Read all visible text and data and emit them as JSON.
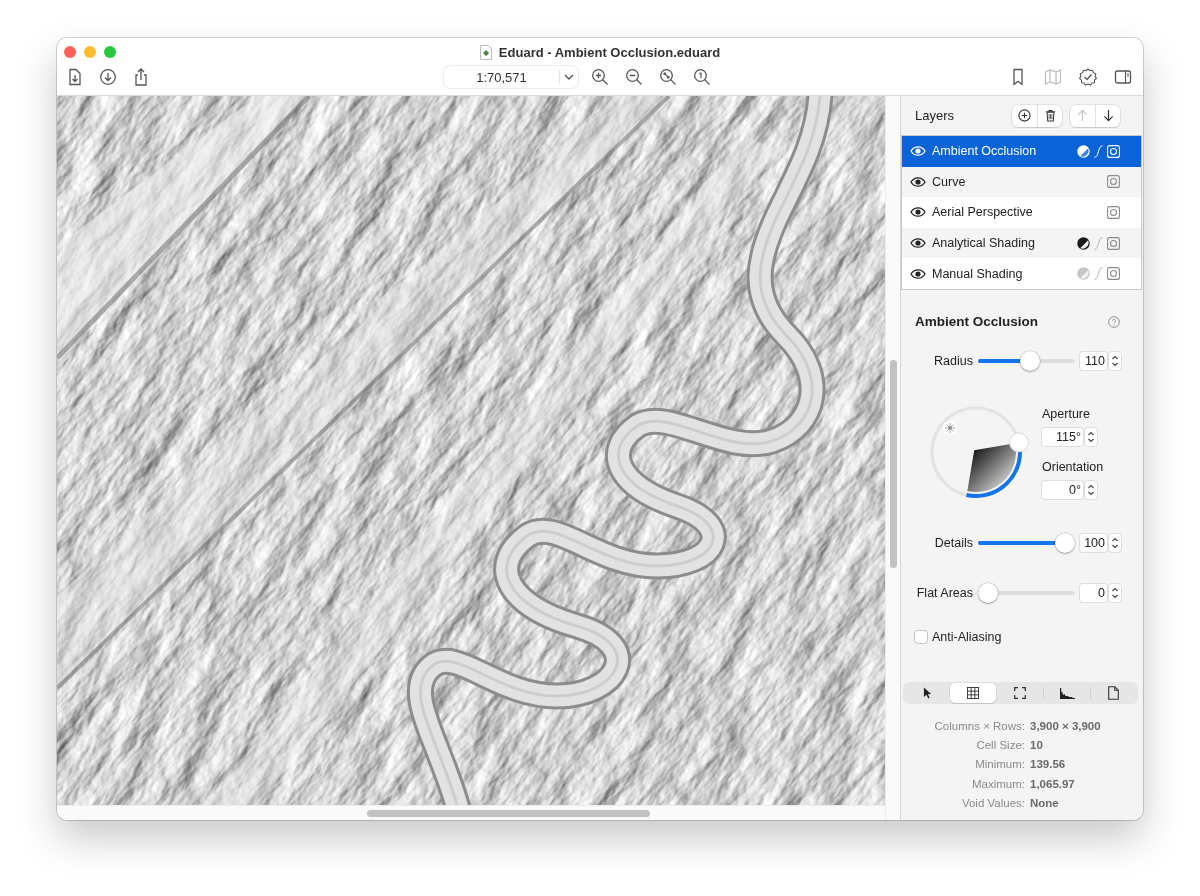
{
  "window": {
    "title": "Eduard - Ambient Occlusion.eduard"
  },
  "toolbar": {
    "scale": "1:70,571",
    "right_buttons": [
      {
        "disabled": false
      },
      {
        "disabled": true
      },
      {
        "disabled": false
      },
      {
        "disabled": false
      }
    ]
  },
  "layers": {
    "title": "Layers",
    "buttons": [
      {
        "disabled": false
      },
      {
        "disabled": false
      },
      {
        "disabled": true
      },
      {
        "disabled": false
      }
    ],
    "items": [
      {
        "name": "Ambient Occlusion",
        "selected": true,
        "visible": true,
        "color": "#ffffff",
        "curve": true,
        "mask": true
      },
      {
        "name": "Curve",
        "selected": false,
        "visible": true,
        "curve": false,
        "mask": true
      },
      {
        "name": "Aerial Perspective",
        "selected": false,
        "visible": true,
        "curve": false,
        "mask": true
      },
      {
        "name": "Analytical Shading",
        "selected": false,
        "visible": true,
        "color": "#1b1b1b",
        "curve": true,
        "mask": true
      },
      {
        "name": "Manual Shading",
        "selected": false,
        "visible": true,
        "color": "#c6c6c6",
        "curve": true,
        "mask": true
      }
    ]
  },
  "inspector": {
    "title": "Ambient Occlusion",
    "radius": {
      "label": "Radius",
      "level": 0.54,
      "value": "110"
    },
    "dial": {
      "aperture_label": "Aperture",
      "aperture": "115°",
      "orientation_label": "Orientation",
      "orientation": "0°"
    },
    "details": {
      "label": "Details",
      "level": 1,
      "value": "100"
    },
    "flat_areas": {
      "label": "Flat Areas",
      "level": 0,
      "value": "0"
    },
    "anti_aliasing": {
      "label": "Anti-Aliasing",
      "checked": false
    }
  },
  "info_tabs": [
    {
      "selected": false
    },
    {
      "selected": true
    },
    {
      "selected": false
    },
    {
      "selected": false
    },
    {
      "selected": false
    }
  ],
  "info": [
    {
      "label": "Columns × Rows:",
      "value": "3,900 × 3,900"
    },
    {
      "label": "Cell Size:",
      "value": "10"
    },
    {
      "label": "Minimum:",
      "value": "139.56"
    },
    {
      "label": "Maximum:",
      "value": "1,065.97"
    },
    {
      "label": "Void Values:",
      "value": "None"
    }
  ]
}
